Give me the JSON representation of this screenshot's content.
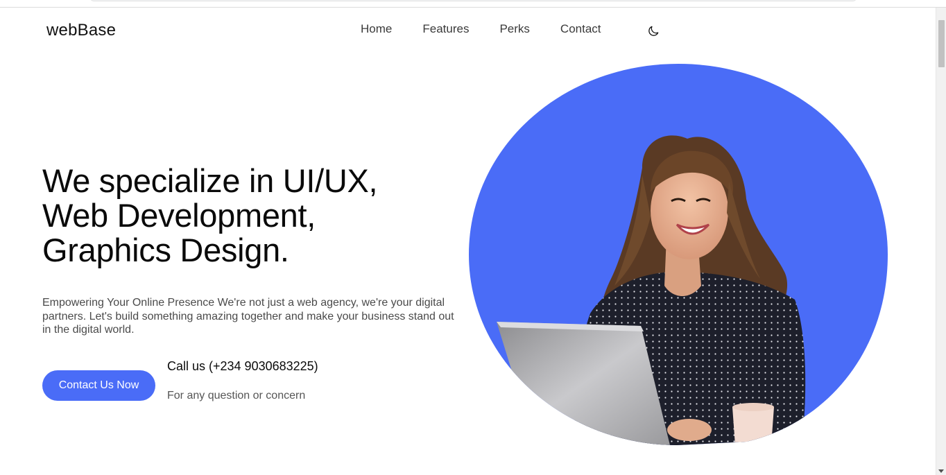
{
  "brand": {
    "name": "webBase"
  },
  "nav": {
    "items": [
      {
        "label": "Home"
      },
      {
        "label": "Features"
      },
      {
        "label": "Perks"
      },
      {
        "label": "Contact"
      }
    ],
    "theme_icon": "moon-icon"
  },
  "hero": {
    "title_lines": [
      "We specialize in UI/UX,",
      "Web Development,",
      "Graphics Design."
    ],
    "description": "Empowering Your Online Presence We're not just a web agency, we're your digital partners. Let's build something amazing together and make your business stand out in the digital world.",
    "cta_label": "Contact Us Now",
    "call_title": "Call us (+234 9030683225)",
    "call_subtitle": "For any question or concern",
    "image_icon": "smiling-woman-with-laptop-photo"
  },
  "colors": {
    "accent": "#4a6cf7",
    "text": "#0a0a0a",
    "muted": "#4a4a4a"
  }
}
